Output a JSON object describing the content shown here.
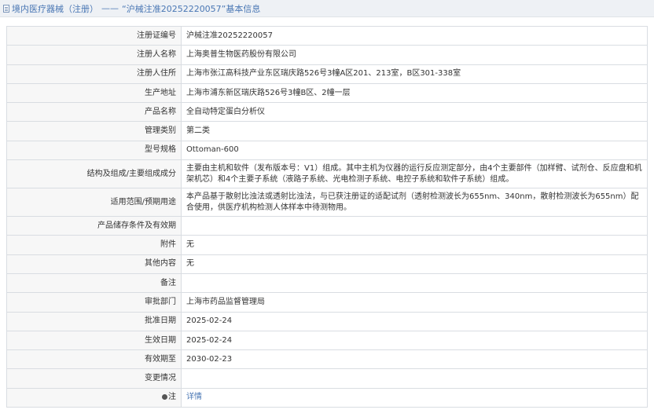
{
  "header": {
    "title": "境内医疗器械（注册）",
    "separator": "——",
    "subtitle": "“沪械注准20252220057”基本信息"
  },
  "rows": [
    {
      "label": "注册证编号",
      "value": "沪械注准20252220057"
    },
    {
      "label": "注册人名称",
      "value": "上海奥普生物医药股份有限公司"
    },
    {
      "label": "注册人住所",
      "value": "上海市张江高科技产业东区瑞庆路526号3幢A区201、213室，B区301-338室"
    },
    {
      "label": "生产地址",
      "value": "上海市浦东新区瑞庆路526号3幢B区、2幢一层"
    },
    {
      "label": "产品名称",
      "value": "全自动特定蛋白分析仪"
    },
    {
      "label": "管理类别",
      "value": "第二类"
    },
    {
      "label": "型号规格",
      "value": "Ottoman-600"
    },
    {
      "label": "结构及组成/主要组成成分",
      "value": "主要由主机和软件（发布版本号：V1）组成。其中主机为仪器的运行反应测定部分，由4个主要部件（加样臂、试剂仓、反应盘和机架机芯）和4个主要子系统（液路子系统、光电检测子系统、电控子系统和软件子系统）组成。"
    },
    {
      "label": "适用范围/预期用途",
      "value": "本产品基于散射比浊法或透射比浊法，与已获注册证的适配试剂（透射检测波长为655nm、340nm，散射检测波长为655nm）配合使用，供医疗机构检测人体样本中待测物用。"
    },
    {
      "label": "产品储存条件及有效期",
      "value": ""
    },
    {
      "label": "附件",
      "value": "无"
    },
    {
      "label": "其他内容",
      "value": "无"
    },
    {
      "label": "备注",
      "value": ""
    },
    {
      "label": "审批部门",
      "value": "上海市药品监督管理局"
    },
    {
      "label": "批准日期",
      "value": "2025-02-24"
    },
    {
      "label": "生效日期",
      "value": "2025-02-24"
    },
    {
      "label": "有效期至",
      "value": "2030-02-23"
    },
    {
      "label": "变更情况",
      "value": ""
    }
  ],
  "note": {
    "label": "注",
    "link": "详情"
  }
}
